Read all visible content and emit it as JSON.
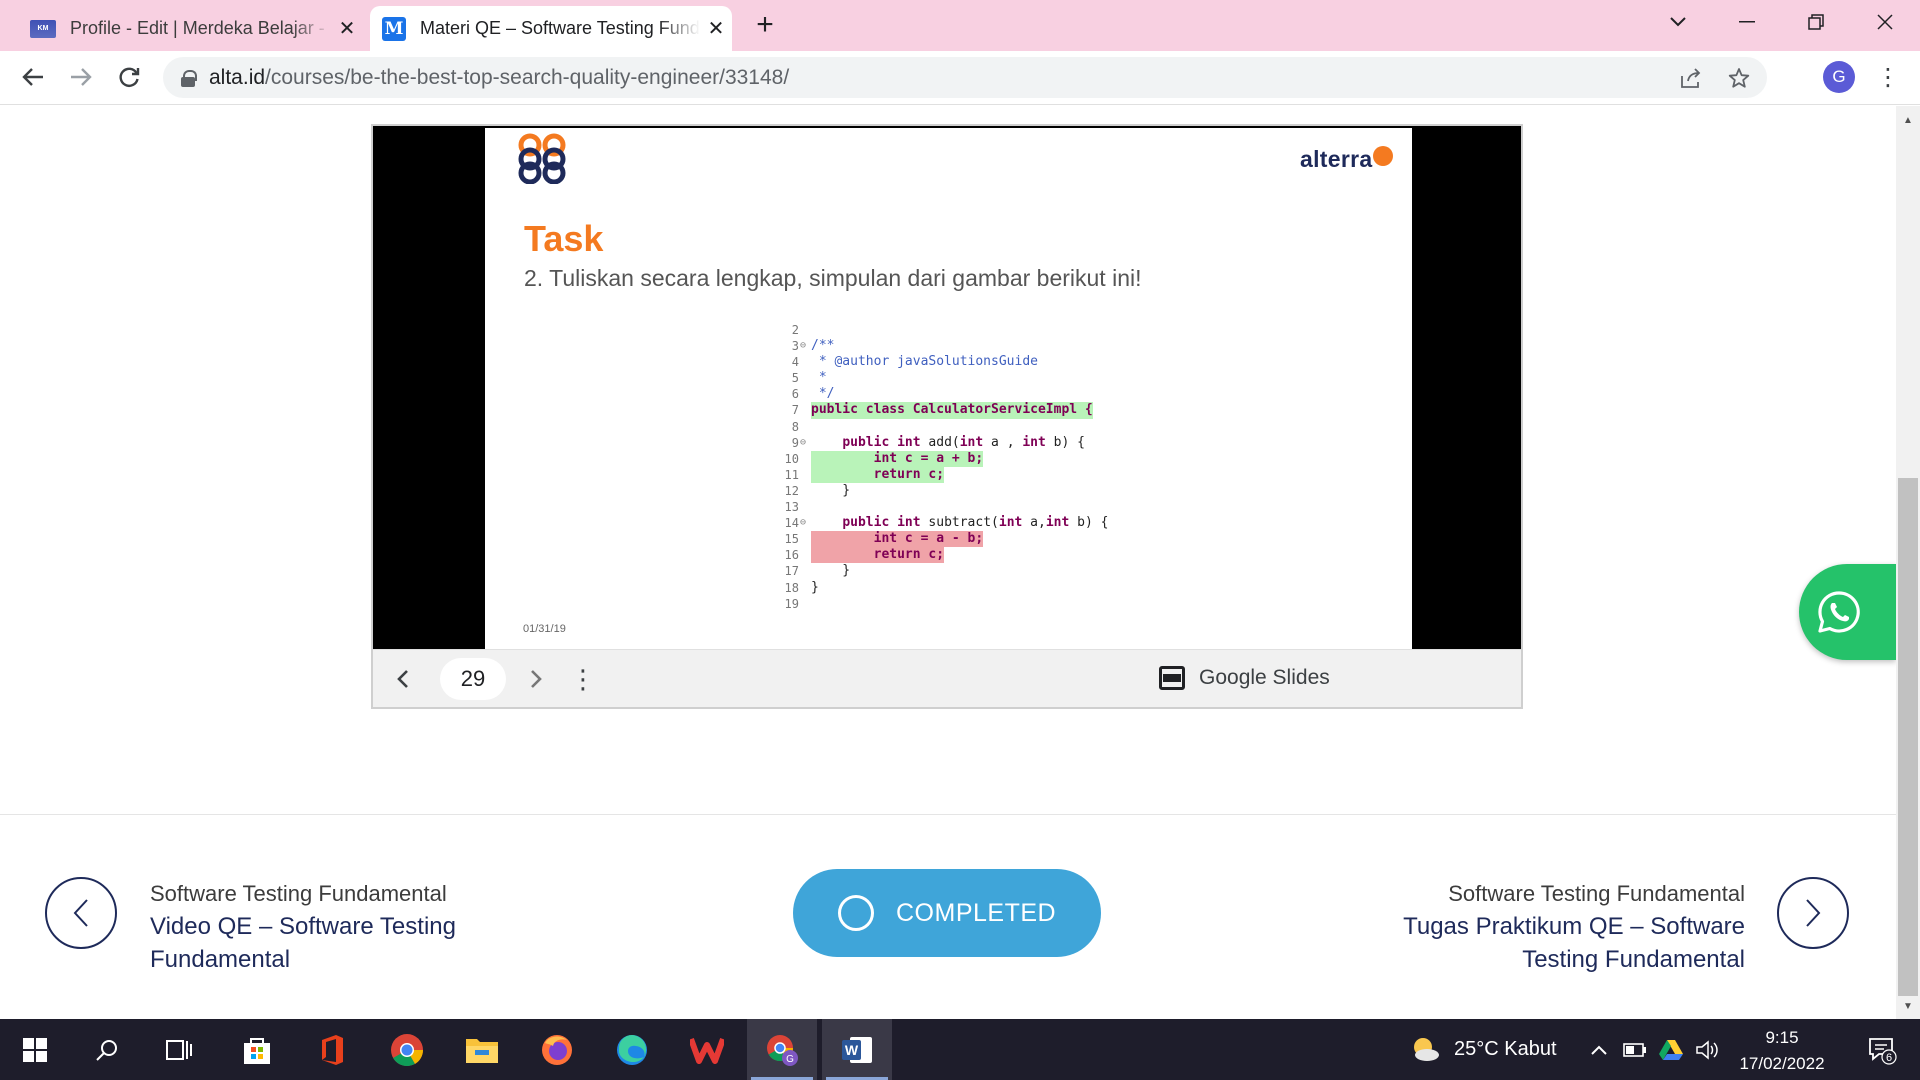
{
  "browser": {
    "tabs": [
      {
        "title": "Profile - Edit | Merdeka Belajar - I",
        "favicon": "kampus-merdeka-favicon",
        "active": false
      },
      {
        "title": "Materi QE – Software Testing Fundamental",
        "favicon": "M",
        "active": true
      }
    ],
    "new_tab": "+",
    "url_host": "alta.id",
    "url_path": "/courses/be-the-best-top-search-quality-engineer/33148/",
    "profile_initial": "G"
  },
  "slides_embed": {
    "brand": "alterra",
    "title": "Task",
    "instruction": "2. Tuliskan secara lengkap, simpulan dari gambar berikut ini!",
    "date": "01/31/19",
    "code_lines": [
      {
        "n": "2",
        "fold": "",
        "text": "",
        "hl": ""
      },
      {
        "n": "3",
        "fold": "⊖",
        "text": "/**",
        "hl": "",
        "style": "cm"
      },
      {
        "n": "4",
        "fold": "",
        "text": " * @author javaSolutionsGuide",
        "hl": "",
        "style": "cm"
      },
      {
        "n": "5",
        "fold": "",
        "text": " *",
        "hl": "",
        "style": "cm"
      },
      {
        "n": "6",
        "fold": "",
        "text": " */",
        "hl": "",
        "style": "cm"
      },
      {
        "n": "7",
        "fold": "",
        "text": "public class CalculatorServiceImpl {",
        "hl": "green",
        "style": "kw"
      },
      {
        "n": "8",
        "fold": "",
        "text": "",
        "hl": ""
      },
      {
        "n": "9",
        "fold": "⊖",
        "text": "    public int add(int a , int b) {",
        "hl": "",
        "style": "mix"
      },
      {
        "n": "10",
        "fold": "",
        "text": "        int c = a + b;",
        "hl": "green",
        "style": "kw"
      },
      {
        "n": "11",
        "fold": "",
        "text": "        return c;",
        "hl": "green",
        "style": "kw"
      },
      {
        "n": "12",
        "fold": "",
        "text": "    }",
        "hl": ""
      },
      {
        "n": "13",
        "fold": "",
        "text": "",
        "hl": ""
      },
      {
        "n": "14",
        "fold": "⊖",
        "text": "    public int subtract(int a,int b) {",
        "hl": "",
        "style": "mix"
      },
      {
        "n": "15",
        "fold": "",
        "text": "        int c = a - b;",
        "hl": "red",
        "style": "kw"
      },
      {
        "n": "16",
        "fold": "",
        "text": "        return c;",
        "hl": "red",
        "style": "kw"
      },
      {
        "n": "17",
        "fold": "",
        "text": "    }",
        "hl": ""
      },
      {
        "n": "18",
        "fold": "",
        "text": "}",
        "hl": ""
      },
      {
        "n": "19",
        "fold": "",
        "text": "",
        "hl": ""
      }
    ],
    "controls": {
      "prev": "‹",
      "page_number": "29",
      "next": "›",
      "more": "⋮",
      "provider_label": "Google Slides"
    }
  },
  "lesson_nav": {
    "prev": {
      "course": "Software Testing Fundamental",
      "title": "Video QE – Software Testing Fundamental"
    },
    "complete_label": "COMPLETED",
    "next": {
      "course": "Software Testing Fundamental",
      "title": "Tugas Praktikum QE – Software Testing Fundamental"
    }
  },
  "taskbar": {
    "weather": "25°C  Kabut",
    "time": "9:15",
    "date": "17/02/2022",
    "notification_count": "6",
    "apps": [
      "start",
      "search",
      "task-view",
      "store",
      "office",
      "chrome",
      "file-explorer",
      "firefox",
      "edge",
      "wps",
      "chrome-profile",
      "word"
    ]
  },
  "colors": {
    "tabstrip": "#f8d0e1",
    "accent_orange": "#f47a20",
    "navy": "#1e2a5a",
    "completed_blue": "#3fa5d9",
    "whatsapp_green": "#25c26a",
    "taskbar": "#1e1d2b"
  }
}
